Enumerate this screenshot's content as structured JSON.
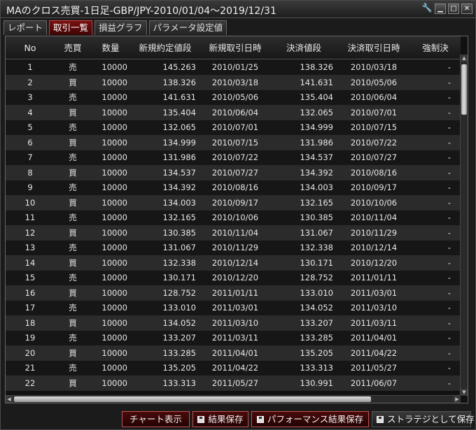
{
  "window": {
    "title": "MAのクロス売買-1日足-GBP/JPY-2010/01/04～2019/12/31",
    "tool_icon": "wrench-icon",
    "min_glyph": "▁",
    "max_glyph": "□",
    "close_glyph": "✕"
  },
  "tabs": [
    {
      "label": "レポート",
      "active": false
    },
    {
      "label": "取引一覧",
      "active": true
    },
    {
      "label": "損益グラフ",
      "active": false
    },
    {
      "label": "パラメータ設定値",
      "active": false
    }
  ],
  "table": {
    "columns": [
      "No",
      "売買",
      "数量",
      "新規約定値段",
      "新規取引日時",
      "決済値段",
      "決済取引日時",
      "強制決"
    ],
    "rows": [
      [
        "1",
        "売",
        "10000",
        "145.263",
        "2010/01/25",
        "138.326",
        "2010/03/18",
        "-"
      ],
      [
        "2",
        "買",
        "10000",
        "138.326",
        "2010/03/18",
        "141.631",
        "2010/05/06",
        "-"
      ],
      [
        "3",
        "売",
        "10000",
        "141.631",
        "2010/05/06",
        "135.404",
        "2010/06/04",
        "-"
      ],
      [
        "4",
        "買",
        "10000",
        "135.404",
        "2010/06/04",
        "132.065",
        "2010/07/01",
        "-"
      ],
      [
        "5",
        "売",
        "10000",
        "132.065",
        "2010/07/01",
        "134.999",
        "2010/07/15",
        "-"
      ],
      [
        "6",
        "買",
        "10000",
        "134.999",
        "2010/07/15",
        "131.986",
        "2010/07/22",
        "-"
      ],
      [
        "7",
        "売",
        "10000",
        "131.986",
        "2010/07/22",
        "134.537",
        "2010/07/27",
        "-"
      ],
      [
        "8",
        "買",
        "10000",
        "134.537",
        "2010/07/27",
        "134.392",
        "2010/08/16",
        "-"
      ],
      [
        "9",
        "売",
        "10000",
        "134.392",
        "2010/08/16",
        "134.003",
        "2010/09/17",
        "-"
      ],
      [
        "10",
        "買",
        "10000",
        "134.003",
        "2010/09/17",
        "132.165",
        "2010/10/06",
        "-"
      ],
      [
        "11",
        "売",
        "10000",
        "132.165",
        "2010/10/06",
        "130.385",
        "2010/11/04",
        "-"
      ],
      [
        "12",
        "買",
        "10000",
        "130.385",
        "2010/11/04",
        "131.067",
        "2010/11/29",
        "-"
      ],
      [
        "13",
        "売",
        "10000",
        "131.067",
        "2010/11/29",
        "132.338",
        "2010/12/14",
        "-"
      ],
      [
        "14",
        "買",
        "10000",
        "132.338",
        "2010/12/14",
        "130.171",
        "2010/12/20",
        "-"
      ],
      [
        "15",
        "売",
        "10000",
        "130.171",
        "2010/12/20",
        "128.752",
        "2011/01/11",
        "-"
      ],
      [
        "16",
        "買",
        "10000",
        "128.752",
        "2011/01/11",
        "133.010",
        "2011/03/01",
        "-"
      ],
      [
        "17",
        "売",
        "10000",
        "133.010",
        "2011/03/01",
        "134.052",
        "2011/03/10",
        "-"
      ],
      [
        "18",
        "買",
        "10000",
        "134.052",
        "2011/03/10",
        "133.207",
        "2011/03/11",
        "-"
      ],
      [
        "19",
        "売",
        "10000",
        "133.207",
        "2011/03/11",
        "133.285",
        "2011/04/01",
        "-"
      ],
      [
        "20",
        "買",
        "10000",
        "133.285",
        "2011/04/01",
        "135.205",
        "2011/04/22",
        "-"
      ],
      [
        "21",
        "売",
        "10000",
        "135.205",
        "2011/04/22",
        "133.313",
        "2011/05/27",
        "-"
      ],
      [
        "22",
        "買",
        "10000",
        "133.313",
        "2011/05/27",
        "130.991",
        "2011/06/07",
        "-"
      ]
    ]
  },
  "buttons": {
    "chart": "チャート表示",
    "save_result": "結果保存",
    "save_performance": "パフォーマンス結果保存",
    "save_strategy": "ストラテジとして保存",
    "save_icon": "floppy-disk-icon"
  },
  "colors": {
    "accent": "#7a1010",
    "background": "#1b1b1b"
  }
}
